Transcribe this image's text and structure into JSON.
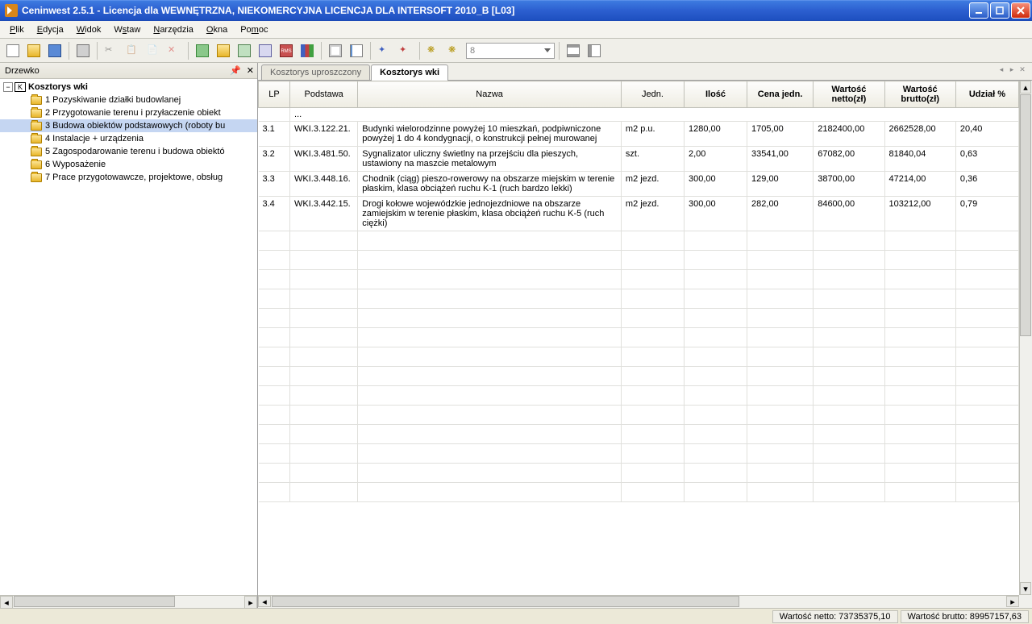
{
  "window": {
    "title": "Ceninwest 2.5.1 - Licencja dla WEWNĘTRZNA, NIEKOMERCYJNA LICENCJA DLA INTERSOFT 2010_B [L03]"
  },
  "menu": {
    "file": "Plik",
    "edit": "Edycja",
    "view": "Widok",
    "insert": "Wstaw",
    "tools": "Narzędzia",
    "windows": "Okna",
    "help": "Pomoc"
  },
  "toolbar": {
    "combo_value": "8"
  },
  "left_panel": {
    "title": "Drzewko",
    "root": "Kosztorys wki",
    "items": [
      "1 Pozyskiwanie działki budowlanej",
      "2 Przygotowanie terenu i przyłaczenie obiekt",
      "3 Budowa obiektów podstawowych (roboty bu",
      "4 Instalacje + urządzenia",
      "5 Zagospodarowanie terenu i budowa obiektó",
      "6 Wyposażenie",
      "7 Prace przygotowawcze, projektowe, obsług"
    ],
    "selected_index": 2
  },
  "tabs": {
    "tab1": "Kosztorys uproszczony",
    "tab2": "Kosztorys wki",
    "active": 1
  },
  "grid": {
    "headers": {
      "lp": "LP",
      "podstawa": "Podstawa",
      "nazwa": "Nazwa",
      "jedn": "Jedn.",
      "ilosc": "Ilość",
      "cena_jedn": "Cena jedn.",
      "wartosc_netto": "Wartość netto(zł)",
      "wartosc_brutto": "Wartość brutto(zł)",
      "udzial": "Udział %"
    },
    "dots": "...",
    "rows": [
      {
        "lp": "3.1",
        "podstawa": "WKI.3.122.21.",
        "nazwa": "Budynki wielorodzinne powyżej 10 mieszkań, podpiwniczone powyżej 1 do 4 kondygnacji, o konstrukcji pełnej murowanej",
        "jedn": "m2 p.u.",
        "ilosc": "1280,00",
        "cena": "1705,00",
        "wn": "2182400,00",
        "wb": "2662528,00",
        "ud": "20,40"
      },
      {
        "lp": "3.2",
        "podstawa": "WKI.3.481.50.",
        "nazwa": "Sygnalizator uliczny świetlny na przejściu dla pieszych, ustawiony na maszcie metalowym",
        "jedn": "szt.",
        "ilosc": "2,00",
        "cena": "33541,00",
        "wn": "67082,00",
        "wb": "81840,04",
        "ud": "0,63"
      },
      {
        "lp": "3.3",
        "podstawa": "WKI.3.448.16.",
        "nazwa": "Chodnik (ciąg) pieszo-rowerowy na obszarze miejskim w terenie płaskim, klasa obciążeń ruchu K-1 (ruch bardzo lekki)",
        "jedn": "m2 jezd.",
        "ilosc": "300,00",
        "cena": "129,00",
        "wn": "38700,00",
        "wb": "47214,00",
        "ud": "0,36"
      },
      {
        "lp": "3.4",
        "podstawa": "WKI.3.442.15.",
        "nazwa": "Drogi kołowe wojewódzkie jednojezdniowe na obszarze zamiejskim w terenie płaskim, klasa obciążeń ruchu K-5 (ruch ciężki)",
        "jedn": "m2 jezd.",
        "ilosc": "300,00",
        "cena": "282,00",
        "wn": "84600,00",
        "wb": "103212,00",
        "ud": "0,79"
      }
    ]
  },
  "statusbar": {
    "netto": "Wartość netto: 73735375,10",
    "brutto": "Wartość brutto: 89957157,63"
  }
}
